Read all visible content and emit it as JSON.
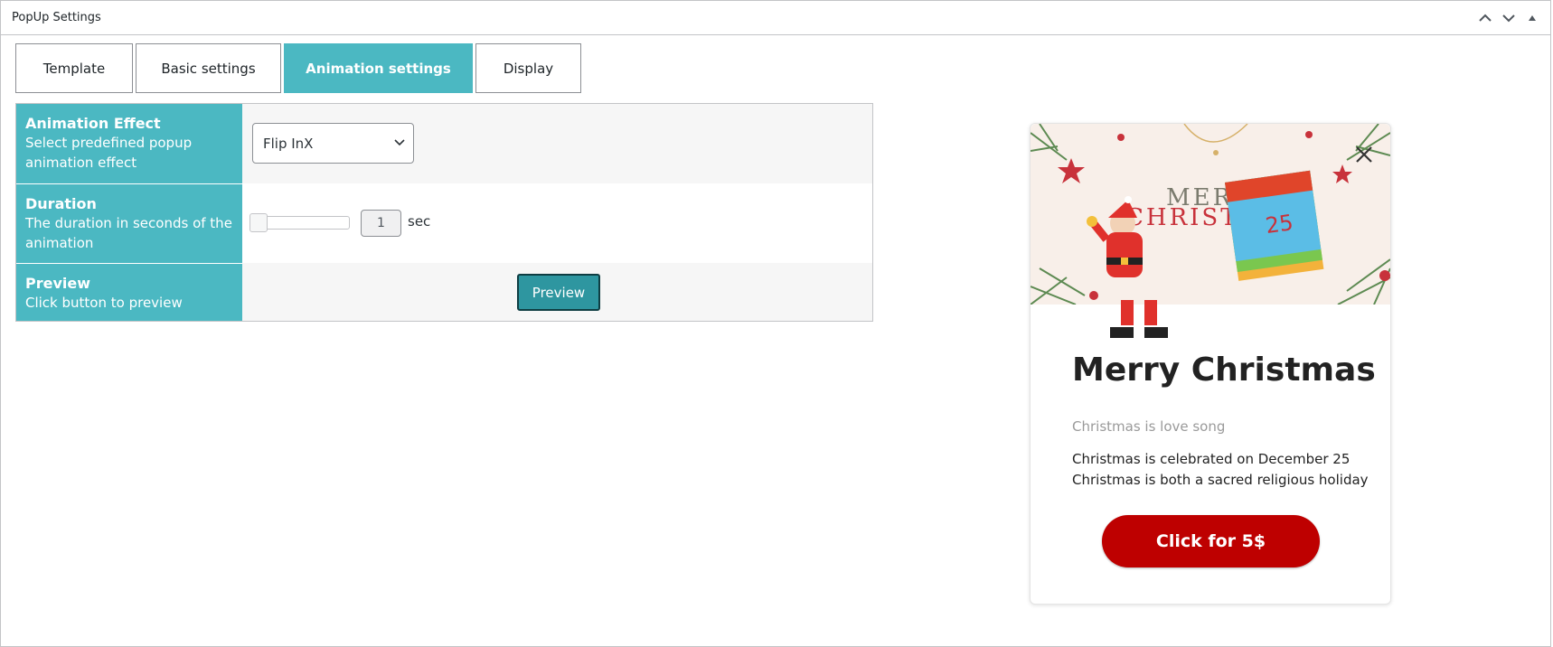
{
  "panel": {
    "title": "PopUp Settings",
    "controls": [
      "chevron-up-icon",
      "chevron-down-icon",
      "triangle-up-icon"
    ]
  },
  "tabs": [
    {
      "label": "Template",
      "active": false
    },
    {
      "label": "Basic settings",
      "active": false
    },
    {
      "label": "Animation settings",
      "active": true
    },
    {
      "label": "Display",
      "active": false
    }
  ],
  "settings": {
    "animation_effect": {
      "title": "Animation Effect",
      "description": "Select predefined popup animation effect",
      "selected": "Flip InX"
    },
    "duration": {
      "title": "Duration",
      "description": "The duration in seconds of the animation",
      "value": "1",
      "unit": "sec",
      "slider_fraction": 0
    },
    "preview": {
      "title": "Preview",
      "description": "Click button to preview",
      "button_label": "Preview"
    }
  },
  "popup_preview": {
    "title": "Merry Christmas",
    "subtitle": "Christmas is love song",
    "lines": [
      "Christmas is celebrated on December 25",
      "Christmas is both a sacred religious holiday"
    ],
    "cta_label": "Click for 5$",
    "banner_text": "MERRY CHRISTMAS",
    "calendar_day": "25",
    "colors": {
      "accent": "#4bb8c2",
      "cta": "#be0000",
      "preview_button": "#2e96a0"
    }
  }
}
